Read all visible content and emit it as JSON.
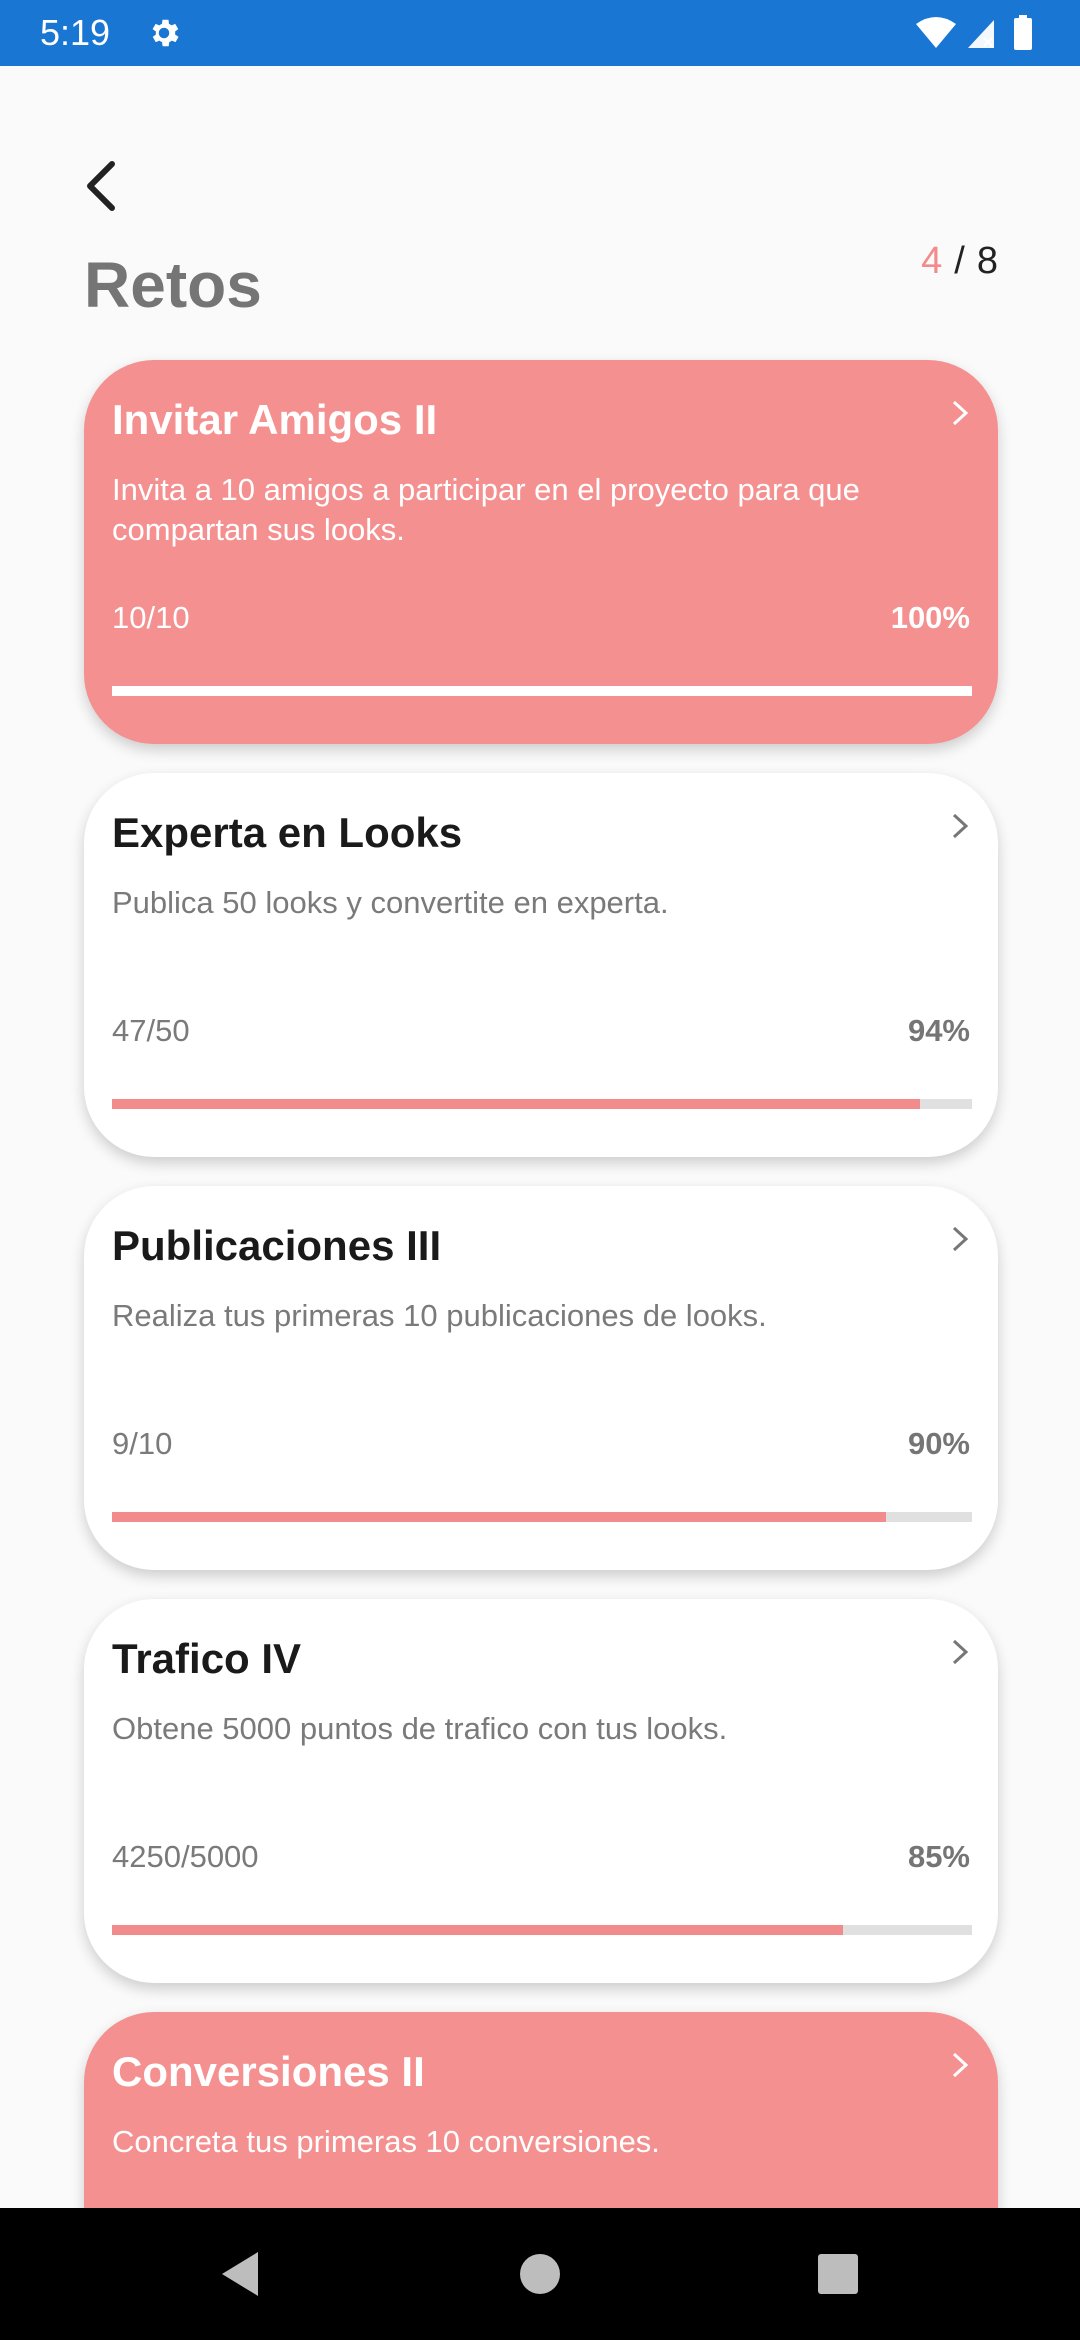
{
  "status": {
    "time": "5:19"
  },
  "header": {
    "title": "Retos",
    "current_page": "4",
    "separator": "/",
    "total_pages": "8"
  },
  "challenges": [
    {
      "title": "Invitar Amigos II",
      "description": "Invita a 10 amigos a participar en el proyecto para que compartan sus looks.",
      "count": "10/10",
      "percent": "100%",
      "progress": 1.0,
      "style": "pink"
    },
    {
      "title": "Experta en Looks",
      "description": "Publica 50 looks y convertite en experta.",
      "count": "47/50",
      "percent": "94%",
      "progress": 0.94,
      "style": "white"
    },
    {
      "title": "Publicaciones III",
      "description": "Realiza tus primeras 10 publicaciones de looks.",
      "count": "9/10",
      "percent": "90%",
      "progress": 0.9,
      "style": "white"
    },
    {
      "title": "Trafico IV",
      "description": "Obtene 5000 puntos de trafico con tus looks.",
      "count": "4250/5000",
      "percent": "85%",
      "progress": 0.85,
      "style": "white"
    },
    {
      "title": "Conversiones II",
      "description": "Concreta tus primeras 10 conversiones.",
      "count": "",
      "percent": "",
      "progress": null,
      "style": "pink"
    }
  ],
  "colors": {
    "accent": "#f28b8b",
    "pink_card": "#f59090",
    "status_bar": "#1976d2"
  }
}
